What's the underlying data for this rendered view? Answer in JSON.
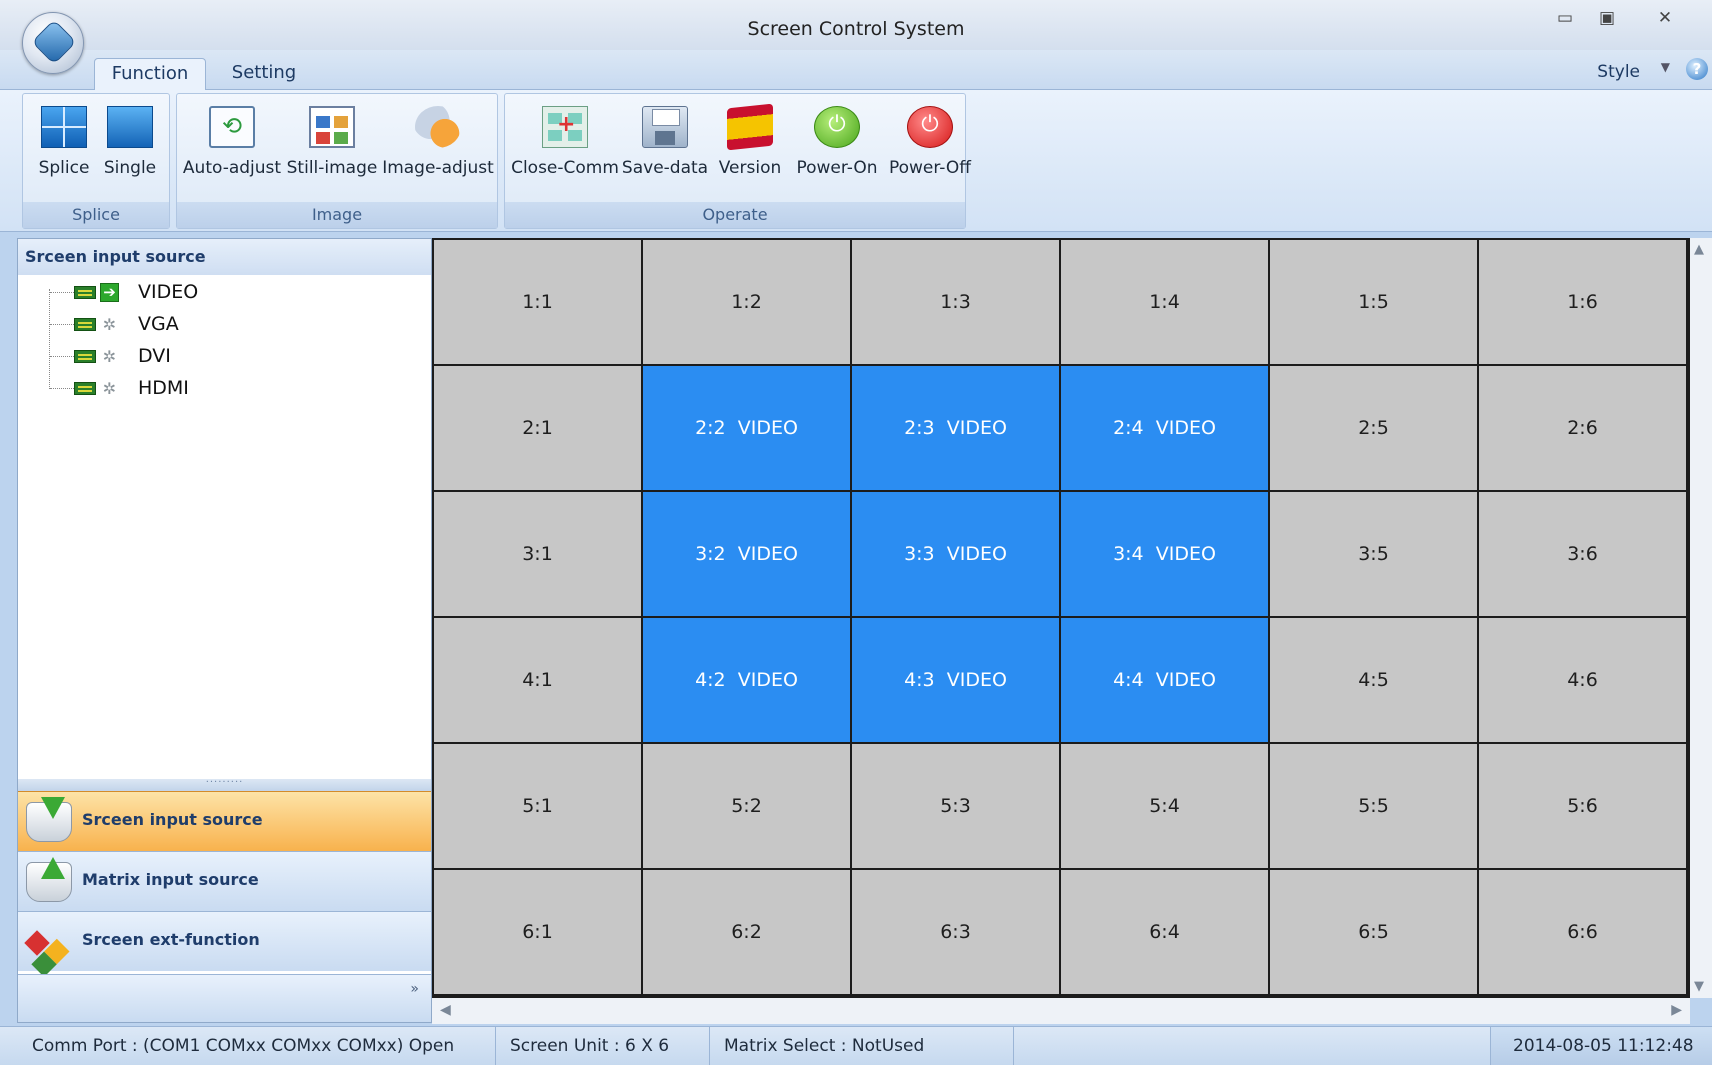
{
  "window": {
    "title": "Screen Control System",
    "controls": [
      "minimize",
      "maximize",
      "close"
    ]
  },
  "tabs": [
    {
      "label": "Function",
      "active": true
    },
    {
      "label": "Setting",
      "active": false
    }
  ],
  "style_menu": {
    "label": "Style"
  },
  "ribbon": {
    "groups": [
      {
        "label": "Splice",
        "buttons": [
          {
            "label": "Splice",
            "icon": "splice-icon"
          },
          {
            "label": "Single",
            "icon": "single-screen-icon"
          }
        ]
      },
      {
        "label": "Image",
        "buttons": [
          {
            "label": "Auto-adjust",
            "icon": "auto-adjust-icon"
          },
          {
            "label": "Still-image",
            "icon": "still-image-icon"
          },
          {
            "label": "Image-adjust",
            "icon": "image-adjust-icon"
          }
        ]
      },
      {
        "label": "Operate",
        "buttons": [
          {
            "label": "Close-Comm",
            "icon": "close-comm-icon"
          },
          {
            "label": "Save-data",
            "icon": "save-icon"
          },
          {
            "label": "Version",
            "icon": "flag-icon"
          },
          {
            "label": "Power-On",
            "icon": "power-on-icon"
          },
          {
            "label": "Power-Off",
            "icon": "power-off-icon"
          }
        ]
      }
    ]
  },
  "left_panel": {
    "header": "Srceen input source",
    "tree": [
      {
        "label": "VIDEO",
        "active": true
      },
      {
        "label": "VGA",
        "active": false
      },
      {
        "label": "DVI",
        "active": false
      },
      {
        "label": "HDMI",
        "active": false
      }
    ],
    "splitter": "·········",
    "nav": [
      {
        "label": "Srceen input source",
        "active": true,
        "icon": "download-arrow-icon"
      },
      {
        "label": "Matrix input source",
        "active": false,
        "icon": "upload-arrow-icon"
      },
      {
        "label": "Srceen ext-function",
        "active": false,
        "icon": "cubes-icon"
      }
    ],
    "more": "»"
  },
  "grid": {
    "rows": 6,
    "cols": 6,
    "cells": [
      [
        "1:1",
        "1:2",
        "1:3",
        "1:4",
        "1:5",
        "1:6"
      ],
      [
        "2:1",
        "2:2  VIDEO",
        "2:3  VIDEO",
        "2:4  VIDEO",
        "2:5",
        "2:6"
      ],
      [
        "3:1",
        "3:2  VIDEO",
        "3:3  VIDEO",
        "3:4  VIDEO",
        "3:5",
        "3:6"
      ],
      [
        "4:1",
        "4:2  VIDEO",
        "4:3  VIDEO",
        "4:4  VIDEO",
        "4:5",
        "4:6"
      ],
      [
        "5:1",
        "5:2",
        "5:3",
        "5:4",
        "5:5",
        "5:6"
      ],
      [
        "6:1",
        "6:2",
        "6:3",
        "6:4",
        "6:5",
        "6:6"
      ]
    ],
    "selected": [
      [
        false,
        false,
        false,
        false,
        false,
        false
      ],
      [
        false,
        true,
        true,
        true,
        false,
        false
      ],
      [
        false,
        true,
        true,
        true,
        false,
        false
      ],
      [
        false,
        true,
        true,
        true,
        false,
        false
      ],
      [
        false,
        false,
        false,
        false,
        false,
        false
      ],
      [
        false,
        false,
        false,
        false,
        false,
        false
      ]
    ],
    "colors": {
      "cell": "#c7c7c7",
      "selected": "#2b8df2",
      "border": "#1c1c1c"
    }
  },
  "status": {
    "comm_port": "Comm Port : (COM1 COMxx COMxx COMxx)  Open",
    "screen_unit": "Screen Unit :  6 X 6",
    "matrix_select": "Matrix Select : NotUsed",
    "datetime": "2014-08-05 11:12:48"
  }
}
